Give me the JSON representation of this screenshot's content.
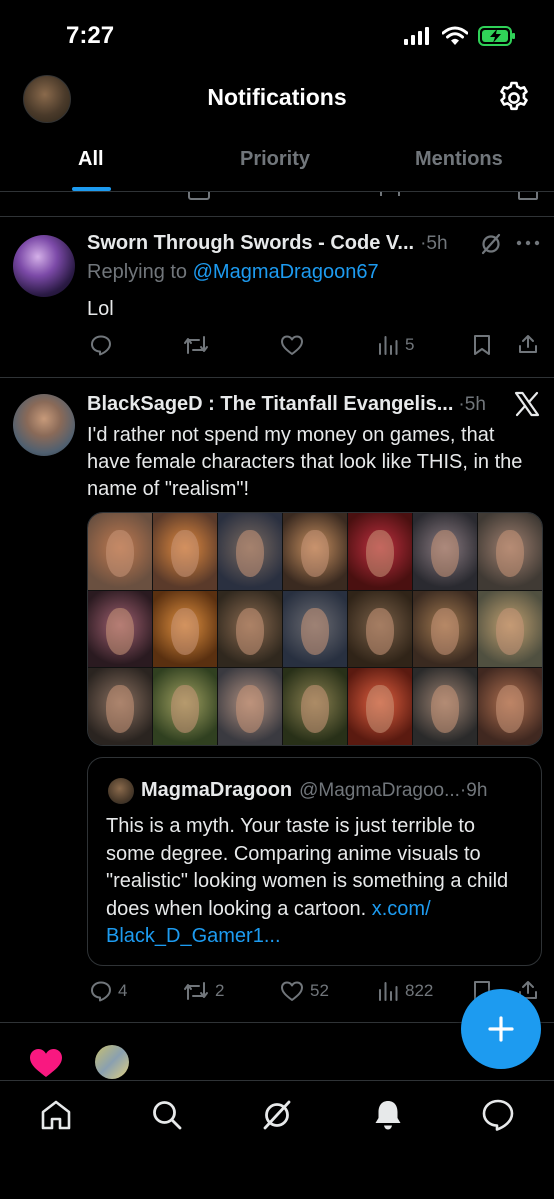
{
  "status": {
    "time": "7:27"
  },
  "header": {
    "title": "Notifications"
  },
  "tabs": [
    {
      "label": "All"
    },
    {
      "label": "Priority"
    },
    {
      "label": "Mentions"
    }
  ],
  "posts": [
    {
      "author": "Sworn Through Swords - Code V...",
      "time": "·5h",
      "replying_prefix": "Replying to ",
      "replying_to": "@MagmaDragoon67",
      "text": "Lol",
      "stats": {
        "replies": "",
        "reposts": "",
        "likes": "",
        "views": "5"
      }
    },
    {
      "author": "BlackSageD : The Titanfall Evangelis...",
      "time": "·5h",
      "text": "I'd rather not spend my money on games, that have female characters that look like THIS, in the name of \"realism\"!",
      "media_faces": 21,
      "quote": {
        "author": "MagmaDragoon",
        "handle": "@MagmaDragoo...",
        "time": "·9h",
        "text": "This is a myth. Your taste is just terrible to some degree. Comparing anime visuals to \"realistic\" looking women is something a child does when looking a cartoon. ",
        "link": "x.com/\nBlack_D_Gamer1..."
      },
      "stats": {
        "replies": "4",
        "reposts": "2",
        "likes": "52",
        "views": "822"
      }
    }
  ],
  "colors": {
    "accent": "#1d9bf0",
    "like_pink": "#f91880",
    "muted": "#71767b"
  },
  "icons": {
    "nav": [
      "home-icon",
      "search-icon",
      "grok-icon",
      "bell-icon",
      "messages-icon"
    ],
    "fab": "plus-icon"
  }
}
